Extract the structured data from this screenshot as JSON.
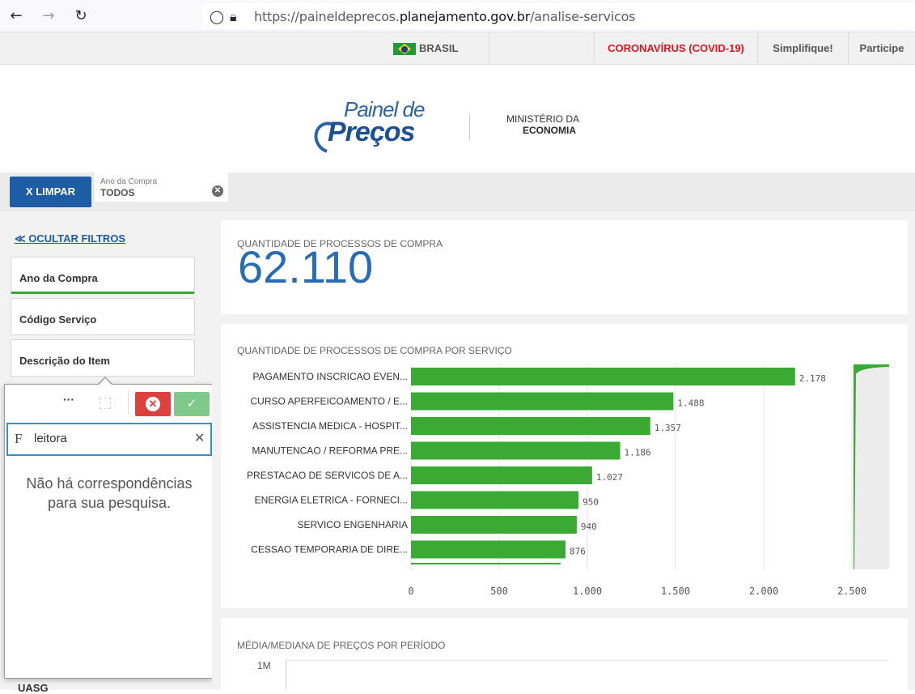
{
  "browser": {
    "url_prefix": "https://paineldeprecos.",
    "url_domain": "planejamento.gov.br",
    "url_path": "/analise-servicos"
  },
  "gov_bar": {
    "country": "BRASIL",
    "covid": "CORONAVÍRUS (COVID-19)",
    "simplifique": "Simplifique!",
    "participe": "Participe"
  },
  "header": {
    "logo_line1": "Painel de",
    "logo_line2": "Preços",
    "ministerio_line1": "MINISTÉRIO DA",
    "ministerio_line2": "ECONOMIA"
  },
  "selections": {
    "clear_label": "X  LIMPAR",
    "chip_label": "Ano da Compra",
    "chip_value": "TODOS"
  },
  "filters": {
    "hide_label": "OCULTAR FILTROS",
    "items": [
      "Ano da Compra",
      "Código Serviço",
      "Descrição do Item"
    ],
    "uasg": "UASG"
  },
  "listbox": {
    "more": "···",
    "search_value": "leitora",
    "search_prefix": "F",
    "no_match": "Não há correspondências para sua pesquisa."
  },
  "kpi": {
    "title": "QUANTIDADE DE PROCESSOS DE COMPRA",
    "value": "62.110"
  },
  "chart_data": [
    {
      "type": "bar",
      "orientation": "horizontal",
      "title": "QUANTIDADE DE PROCESSOS DE COMPRA POR SERVIÇO",
      "categories": [
        "PAGAMENTO INSCRICAO EVEN...",
        "CURSO APERFEICOAMENTO / E...",
        "ASSISTENCIA MEDICA - HOSPIT...",
        "MANUTENCAO / REFORMA PRE...",
        "PRESTACAO DE SERVICOS DE A...",
        "ENERGIA ELETRICA - FORNECI...",
        "SERVICO ENGENHARIA",
        "CESSAO TEMPORARIA DE DIRE..."
      ],
      "values": [
        2178,
        1488,
        1357,
        1186,
        1027,
        950,
        940,
        876
      ],
      "value_labels": [
        "2.178",
        "1.488",
        "1.357",
        "1.186",
        "1.027",
        "950",
        "940",
        "876"
      ],
      "xlim": [
        0,
        2700
      ],
      "xticks": [
        0,
        500,
        1000,
        1500,
        2000,
        2500
      ],
      "xtick_labels": [
        "0",
        "500",
        "1.000",
        "1.500",
        "2.000",
        "2.500"
      ],
      "grid": true,
      "bar_color": "#3aaa35"
    },
    {
      "type": "line",
      "title": "MÉDIA/MEDIANA DE PREÇOS POR PERÍODO",
      "ytick_labels": [
        "1M"
      ]
    }
  ]
}
